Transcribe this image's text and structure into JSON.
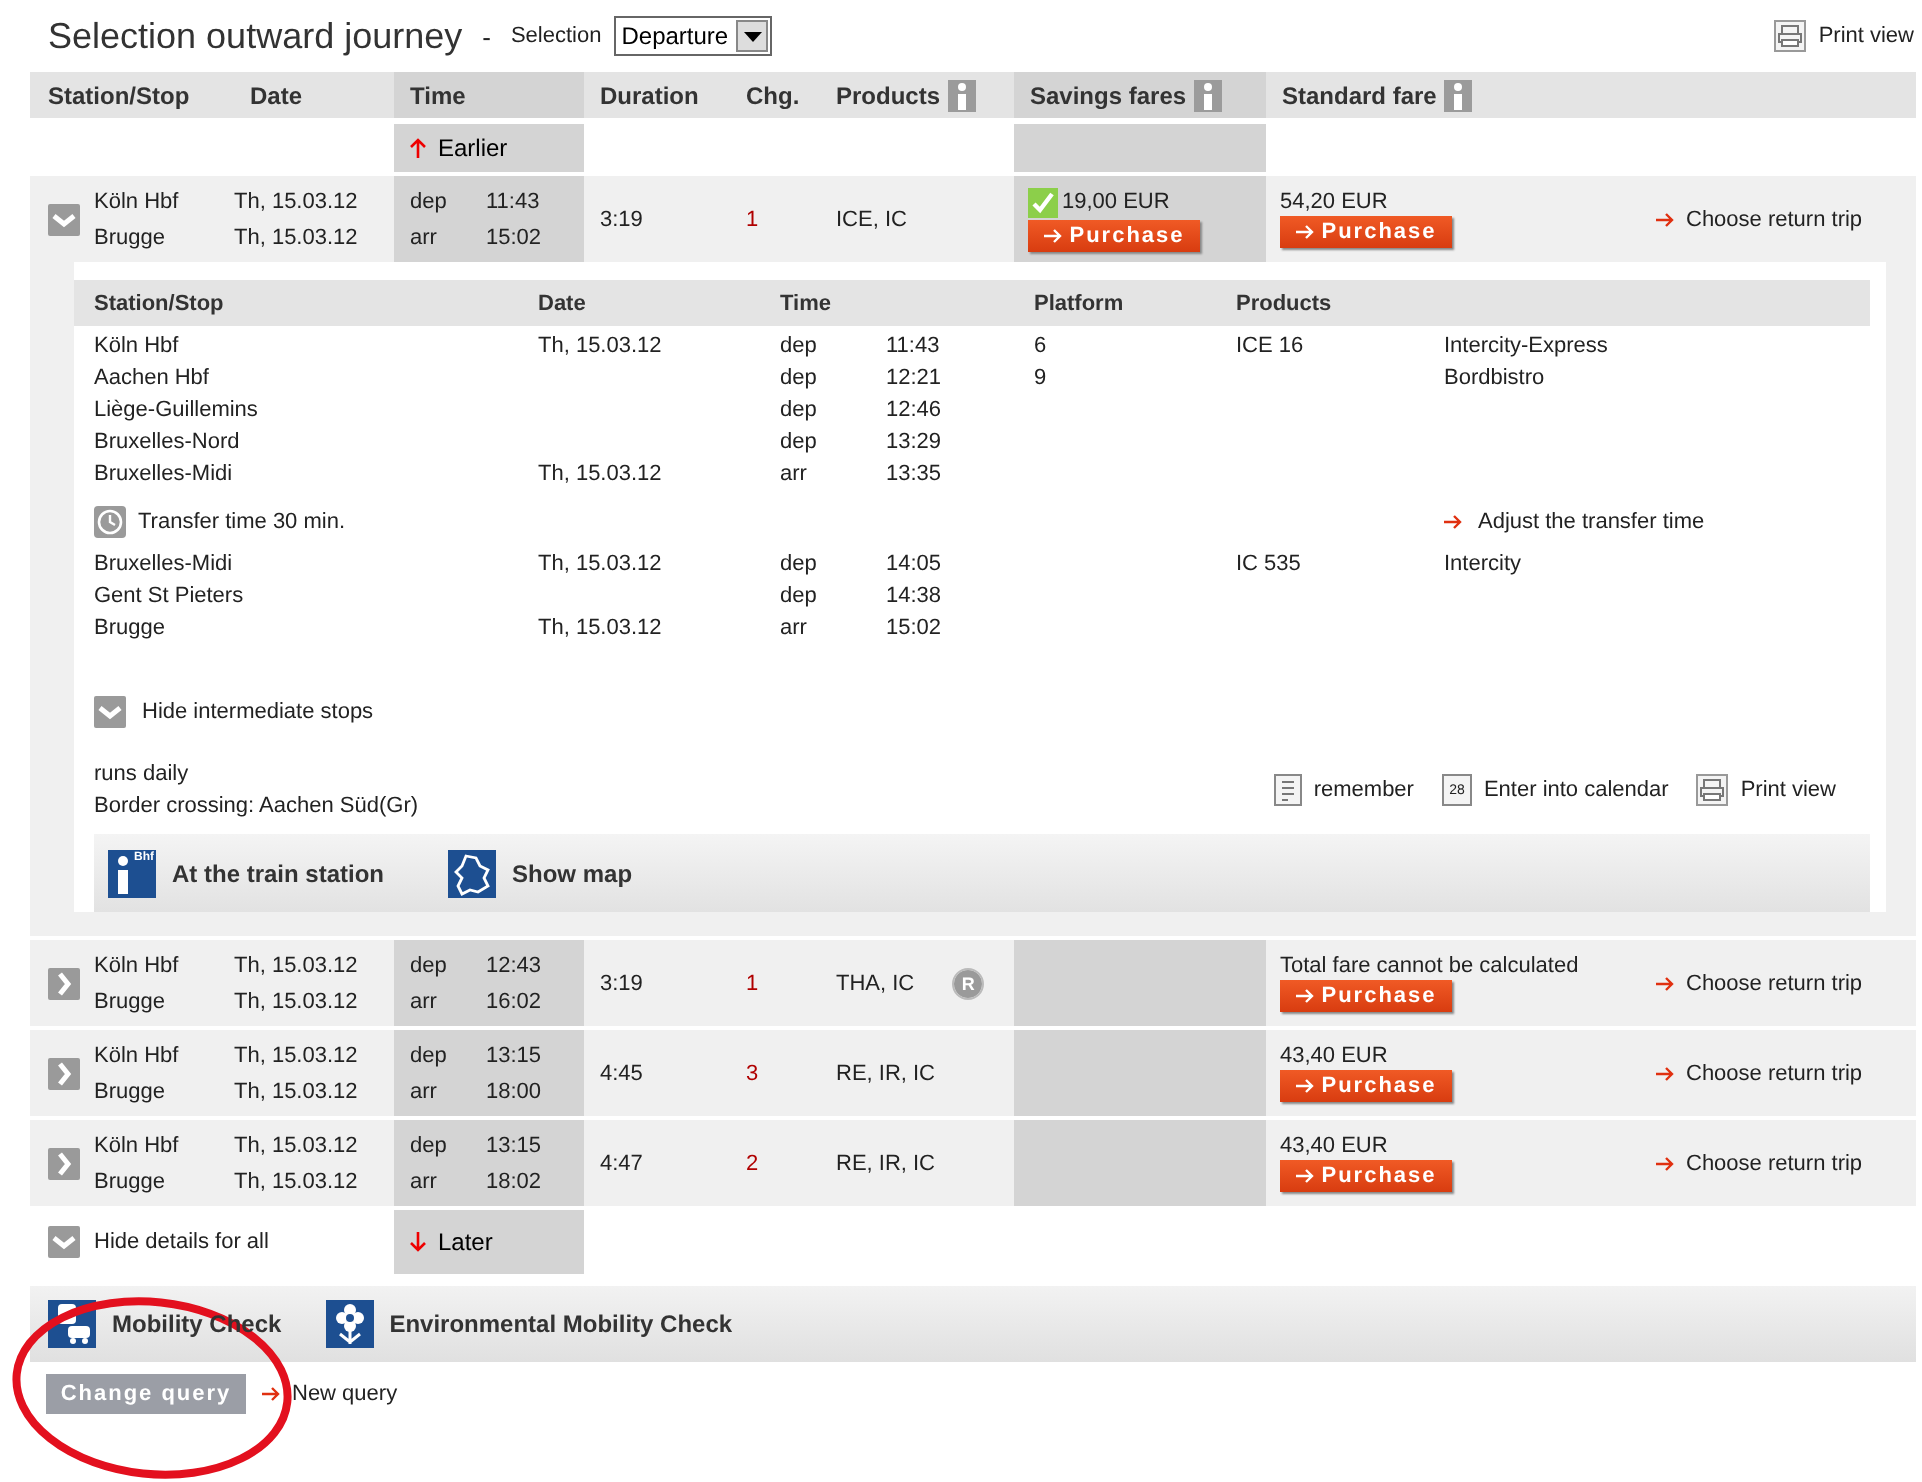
{
  "header": {
    "title": "Selection outward journey",
    "separator": "-",
    "selection_label": "Selection",
    "selection_value": "Departure",
    "print_view": "Print view"
  },
  "columns": [
    {
      "label": "Station/Stop",
      "info": false
    },
    {
      "label": "Date",
      "info": false
    },
    {
      "label": "Time",
      "info": false
    },
    {
      "label": "Duration",
      "info": false
    },
    {
      "label": "Chg.",
      "info": false
    },
    {
      "label": "Products",
      "info": true
    },
    {
      "label": "Savings fares",
      "info": true
    },
    {
      "label": "Standard fare",
      "info": true
    }
  ],
  "earlier": "Earlier",
  "connections": [
    {
      "expanded": true,
      "from": "Köln Hbf",
      "to": "Brugge",
      "date_from": "Th, 15.03.12",
      "date_to": "Th, 15.03.12",
      "dep_label": "dep",
      "dep": "11:43",
      "arr_label": "arr",
      "arr": "15:02",
      "duration": "3:19",
      "changes": "1",
      "products": "ICE, IC",
      "savings": {
        "checked": true,
        "price": "19,00 EUR",
        "button": "Purchase"
      },
      "standard": {
        "price": "54,20 EUR",
        "button": "Purchase"
      },
      "return": "Choose return trip",
      "details": {
        "columns": [
          "Station/Stop",
          "Date",
          "Time",
          "Platform",
          "Products"
        ],
        "rows": [
          {
            "kind": "stop",
            "station": "Köln Hbf",
            "date": "Th, 15.03.12",
            "dir": "dep",
            "time": "11:43",
            "platform": "6",
            "product": "ICE 16",
            "info": "Intercity-Express"
          },
          {
            "kind": "stop",
            "station": "Aachen Hbf",
            "dir": "dep",
            "time": "12:21",
            "platform": "9",
            "info": "Bordbistro"
          },
          {
            "kind": "stop",
            "station": "Liège-Guillemins",
            "dir": "dep",
            "time": "12:46"
          },
          {
            "kind": "stop",
            "station": "Bruxelles-Nord",
            "dir": "dep",
            "time": "13:29"
          },
          {
            "kind": "stop",
            "station": "Bruxelles-Midi",
            "date": "Th, 15.03.12",
            "dir": "arr",
            "time": "13:35"
          },
          {
            "kind": "transfer",
            "text": "Transfer time 30 min.",
            "link": "Adjust the transfer time"
          },
          {
            "kind": "stop",
            "station": "Bruxelles-Midi",
            "date": "Th, 15.03.12",
            "dir": "dep",
            "time": "14:05",
            "product": "IC 535",
            "info": "Intercity"
          },
          {
            "kind": "stop",
            "station": "Gent St Pieters",
            "dir": "dep",
            "time": "14:38"
          },
          {
            "kind": "stop",
            "station": "Brugge",
            "date": "Th, 15.03.12",
            "dir": "arr",
            "time": "15:02"
          }
        ],
        "hide_stops": "Hide intermediate stops",
        "notes": [
          "runs daily",
          "Border crossing: Aachen Süd(Gr)"
        ],
        "actions": [
          {
            "kind": "remember",
            "label": "remember"
          },
          {
            "kind": "calendar",
            "label": "Enter into calendar",
            "icon_text": "28"
          },
          {
            "kind": "print",
            "label": "Print view"
          }
        ],
        "services": [
          {
            "kind": "station",
            "label": "At the train station",
            "icon_text": "Bhf"
          },
          {
            "kind": "map",
            "label": "Show map"
          }
        ]
      }
    },
    {
      "expanded": false,
      "from": "Köln Hbf",
      "to": "Brugge",
      "date_from": "Th, 15.03.12",
      "date_to": "Th, 15.03.12",
      "dep_label": "dep",
      "dep": "12:43",
      "arr_label": "arr",
      "arr": "16:02",
      "duration": "3:19",
      "changes": "1",
      "products": "THA, IC",
      "badge": "R",
      "standard": {
        "price": "Total fare cannot be calculated",
        "button": "Purchase"
      },
      "return": "Choose return trip"
    },
    {
      "expanded": false,
      "from": "Köln Hbf",
      "to": "Brugge",
      "date_from": "Th, 15.03.12",
      "date_to": "Th, 15.03.12",
      "dep_label": "dep",
      "dep": "13:15",
      "arr_label": "arr",
      "arr": "18:00",
      "duration": "4:45",
      "changes": "3",
      "products": "RE, IR, IC",
      "standard": {
        "price": "43,40 EUR",
        "button": "Purchase"
      },
      "return": "Choose return trip"
    },
    {
      "expanded": false,
      "from": "Köln Hbf",
      "to": "Brugge",
      "date_from": "Th, 15.03.12",
      "date_to": "Th, 15.03.12",
      "dep_label": "dep",
      "dep": "13:15",
      "arr_label": "arr",
      "arr": "18:02",
      "duration": "4:47",
      "changes": "2",
      "products": "RE, IR, IC",
      "standard": {
        "price": "43,40 EUR",
        "button": "Purchase"
      },
      "return": "Choose return trip"
    }
  ],
  "hide_all": "Hide details for all",
  "later": "Later",
  "checks": [
    {
      "kind": "mobility",
      "label": "Mobility Check"
    },
    {
      "kind": "environment",
      "label": "Environmental Mobility Check"
    }
  ],
  "change_query": "Change query",
  "new_query": "New query"
}
